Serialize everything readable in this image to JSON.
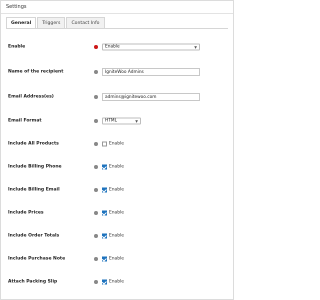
{
  "panel": {
    "title": "Settings"
  },
  "tabs": [
    {
      "label": "General",
      "active": true
    },
    {
      "label": "Triggers",
      "active": false
    },
    {
      "label": "Contact Info",
      "active": false
    }
  ],
  "fields": {
    "enable": {
      "label": "Enable",
      "value": "Enable"
    },
    "recipient": {
      "label": "Name of the recipient",
      "value": "IgniteWoo Admins"
    },
    "email": {
      "label": "Email Address(es)",
      "value": "admins@ignitewoo.com"
    },
    "format": {
      "label": "Email Format",
      "value": "HTML"
    },
    "all_products": {
      "label": "Include All Products",
      "text": "Enable",
      "checked": false
    },
    "billing_phone": {
      "label": "Include Billing Phone",
      "text": "Enable",
      "checked": true
    },
    "billing_email": {
      "label": "Include Billing Email",
      "text": "Enable",
      "checked": true
    },
    "prices": {
      "label": "Include Prices",
      "text": "Enable",
      "checked": true
    },
    "order_totals": {
      "label": "Include Order Totals",
      "text": "Enable",
      "checked": true
    },
    "purchase_note": {
      "label": "Include Purchase Note",
      "text": "Enable",
      "checked": true
    },
    "packing_slip": {
      "label": "Attach Packing Slip",
      "text": "Enable",
      "checked": true
    }
  },
  "icons": {
    "help": "help-circle-icon",
    "caret": "chevron-down-icon"
  },
  "colors": {
    "checked": "#1e73be",
    "required_help": "#cc1818",
    "help": "#888888"
  }
}
